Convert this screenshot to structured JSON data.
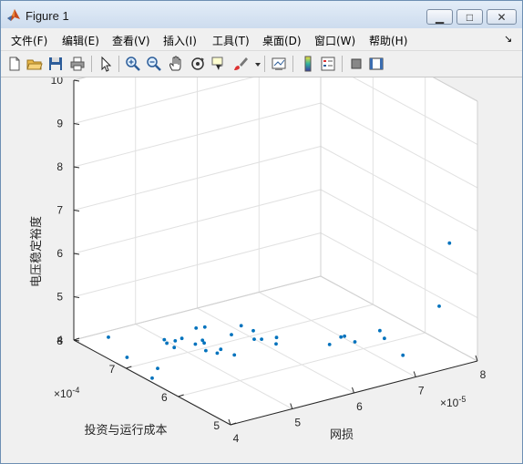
{
  "window": {
    "title": "Figure 1"
  },
  "menu": {
    "items": [
      "文件(F)",
      "编辑(E)",
      "查看(V)",
      "插入(I)",
      "工具(T)",
      "桌面(D)",
      "窗口(W)",
      "帮助(H)"
    ]
  },
  "toolbar": {
    "buttons": [
      "new-figure",
      "open-file",
      "save",
      "print",
      "edit-plot",
      "zoom-in",
      "zoom-out",
      "pan",
      "rotate-3d",
      "data-cursor",
      "brush",
      "brush-dropdown",
      "link-plot",
      "insert-colorbar",
      "insert-legend",
      "hide-plot-tools",
      "show-plot-tools"
    ]
  },
  "colors": {
    "accent": "#0072bd",
    "axes_background": "#ffffff",
    "window_background": "#f0f0f0"
  },
  "chart_data": {
    "type": "scatter",
    "dimensions": 3,
    "xlabel": "网损",
    "ylabel": "投资与运行成本",
    "zlabel": "电压稳定裕度",
    "x_exponent": "×10^-5",
    "y_exponent": "×10^-4",
    "xlim": [
      4,
      8
    ],
    "ylim": [
      5,
      8
    ],
    "zlim": [
      4,
      10
    ],
    "x_ticks": [
      "4",
      "5",
      "6",
      "7",
      "8"
    ],
    "y_ticks": [
      "5",
      "6",
      "7",
      "8"
    ],
    "z_ticks": [
      "4",
      "5",
      "6",
      "7",
      "8",
      "9",
      "10"
    ],
    "grid": true,
    "marker_color": "#0072bd",
    "points": [
      [
        4.35,
        7.75,
        4.1
      ],
      [
        4.1,
        7.1,
        4.15
      ],
      [
        4.0,
        6.5,
        4.1
      ],
      [
        4.3,
        6.75,
        4.05
      ],
      [
        5.0,
        7.45,
        4.0
      ],
      [
        5.0,
        7.4,
        3.95
      ],
      [
        4.95,
        7.2,
        4.0
      ],
      [
        5.05,
        7.3,
        4.05
      ],
      [
        5.2,
        7.35,
        4.02
      ],
      [
        5.25,
        7.15,
        4.0
      ],
      [
        5.35,
        7.1,
        4.02
      ],
      [
        5.25,
        6.95,
        3.98
      ],
      [
        5.35,
        6.85,
        3.95
      ],
      [
        5.45,
        6.9,
        3.97
      ],
      [
        5.45,
        7.25,
        3.95
      ],
      [
        5.6,
        7.55,
        3.98
      ],
      [
        5.7,
        7.5,
        4.0
      ],
      [
        5.5,
        6.7,
        3.95
      ],
      [
        5.75,
        7.05,
        4.1
      ],
      [
        5.95,
        7.1,
        4.2
      ],
      [
        5.95,
        6.85,
        4.05
      ],
      [
        5.85,
        6.75,
        4.35
      ],
      [
        5.9,
        6.65,
        4.2
      ],
      [
        6.05,
        6.55,
        4.1
      ],
      [
        6.1,
        6.6,
        4.2
      ],
      [
        6.45,
        6.0,
        4.3
      ],
      [
        6.55,
        5.9,
        4.5
      ],
      [
        6.65,
        5.95,
        4.45
      ],
      [
        6.65,
        5.75,
        4.45
      ],
      [
        6.8,
        5.45,
        4.85
      ],
      [
        7.0,
        5.6,
        4.5
      ],
      [
        7.3,
        5.6,
        4.0
      ],
      [
        7.55,
        5.2,
        5.3
      ],
      [
        7.8,
        5.3,
        6.6
      ]
    ]
  }
}
